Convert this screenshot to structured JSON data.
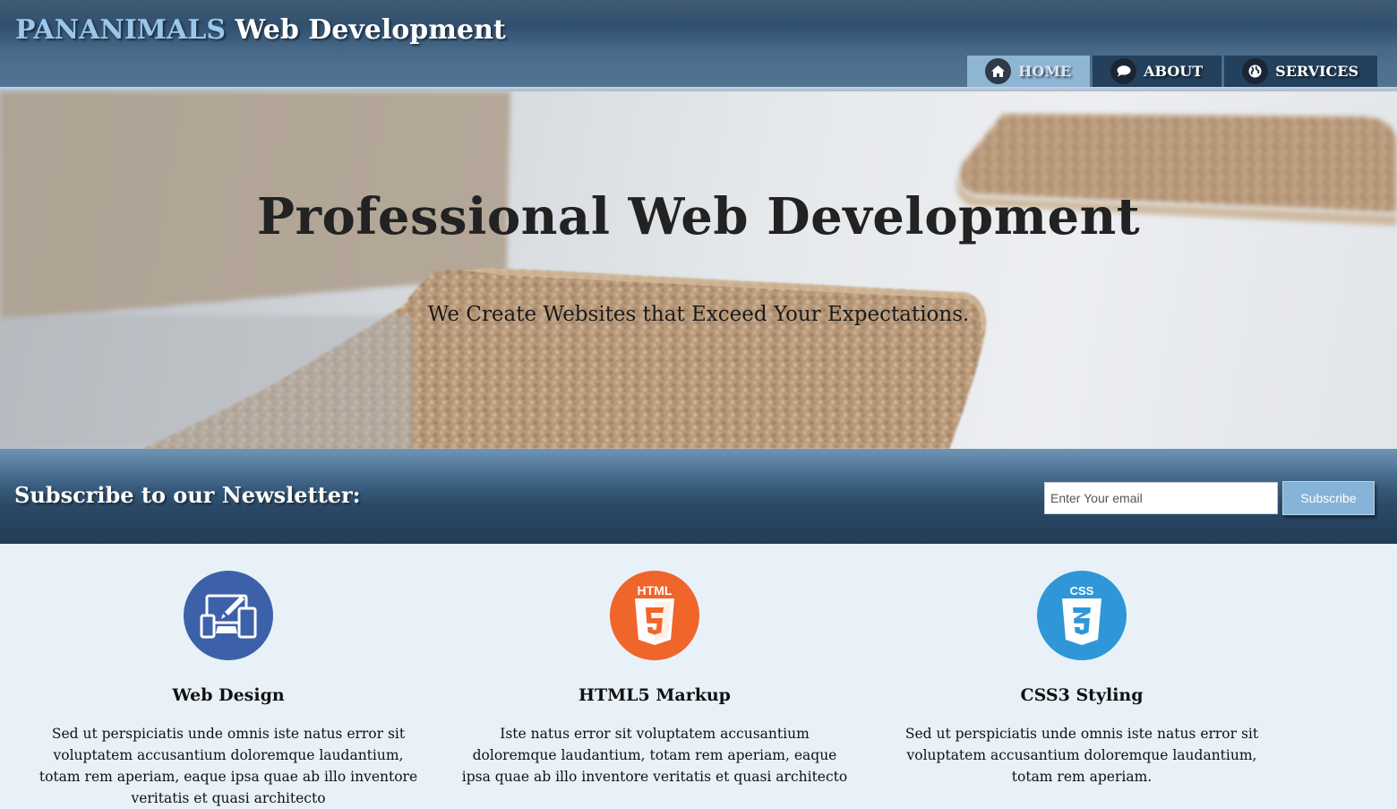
{
  "header": {
    "brand_accent": "PANANIMALS",
    "brand_rest": "Web Development"
  },
  "nav": {
    "items": [
      {
        "label": "HOME",
        "icon": "home-icon",
        "active": true
      },
      {
        "label": "ABOUT",
        "icon": "chat-icon",
        "active": false
      },
      {
        "label": "SERVICES",
        "icon": "globe-icon",
        "active": false
      }
    ]
  },
  "hero": {
    "title": "Professional Web Development",
    "subtitle": "We Create Websites that Exceed Your Expectations."
  },
  "newsletter": {
    "label": "Subscribe to our Newsletter:",
    "email_placeholder": "Enter Your email",
    "button_label": "Subscribe"
  },
  "features": [
    {
      "title": "Web Design",
      "icon": "devices-icon",
      "icon_color": "#3d61a8",
      "text": "Sed ut perspiciatis unde omnis iste natus error sit voluptatem accusantium doloremque laudantium, totam rem aperiam, eaque ipsa quae ab illo inventore veritatis et quasi architecto"
    },
    {
      "title": "HTML5 Markup",
      "icon": "html5-icon",
      "icon_color": "#f06529",
      "text": "Iste natus error sit voluptatem accusantium doloremque laudantium, totam rem aperiam, eaque ipsa quae ab illo inventore veritatis et quasi architecto"
    },
    {
      "title": "CSS3 Styling",
      "icon": "css3-icon",
      "icon_color": "#2f97d7",
      "text": "Sed ut perspiciatis unde omnis iste natus error sit voluptatem accusantium doloremque laudantium, totam rem aperiam."
    }
  ],
  "colors": {
    "header_dark": "#2b4763",
    "nav_active": "#8fb5d4",
    "page_bg": "#e8f1f8"
  }
}
